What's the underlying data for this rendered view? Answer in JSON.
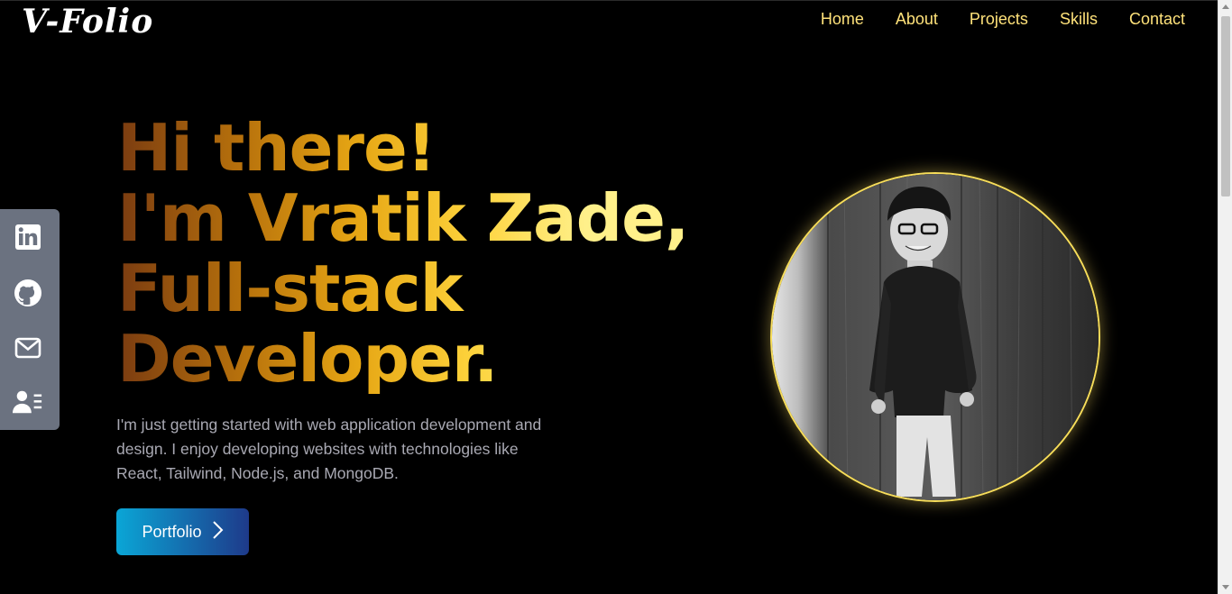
{
  "brand": {
    "logo": "V-Folio"
  },
  "nav": {
    "home": "Home",
    "about": "About",
    "projects": "Projects",
    "skills": "Skills",
    "contact": "Contact"
  },
  "social": [
    "linkedin-icon",
    "github-icon",
    "mail-icon",
    "contact-card-icon"
  ],
  "hero": {
    "line1": "Hi there!",
    "line2": "I'm Vratik Zade,",
    "line3": "Full-stack",
    "line4": "Developer.",
    "intro": "I'm just getting started with web application development and design. I enjoy developing websites with technologies like React, Tailwind, Node.js, and MongoDB.",
    "cta": "Portfolio"
  },
  "colors": {
    "nav_link": "#ffe27a",
    "gradient_start": "#7a3b10",
    "gradient_end": "#fff08a",
    "button_start": "#0aa6d6",
    "button_end": "#1e3a8a",
    "sidebar": "#6b7280",
    "avatar_border": "#f7dd5a"
  }
}
